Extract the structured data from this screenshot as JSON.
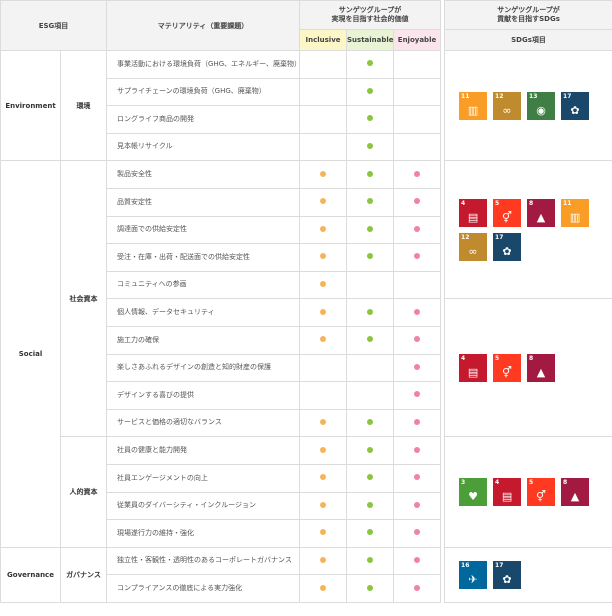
{
  "header": {
    "esg": "ESG項目",
    "materiality": "マテリアリティ（重要課題）",
    "value_title_1": "サンゲツグループが",
    "value_title_2": "実現を目指す社会的価値",
    "sdgs_title_1": "サンゲツグループが",
    "sdgs_title_2": "貢献を目指すSDGs",
    "inclusive": "Inclusive",
    "sustainable": "Sustainable",
    "enjoyable": "Enjoyable",
    "sdgs_item": "SDGs項目"
  },
  "categories": {
    "environment": "Environment",
    "environment_sub": "環境",
    "social": "Social",
    "social_sub1": "社会資本",
    "social_sub2": "人的資本",
    "governance": "Governance",
    "governance_sub": "ガバナンス"
  },
  "rows": [
    {
      "label": "事業活動における環境負荷（GHG、エネルギー、廃棄物）",
      "inclusive": false,
      "sustainable": true,
      "enjoyable": false
    },
    {
      "label": "サプライチェーンの環境負荷（GHG、廃棄物）",
      "inclusive": false,
      "sustainable": true,
      "enjoyable": false
    },
    {
      "label": "ロングライフ商品の開発",
      "inclusive": false,
      "sustainable": true,
      "enjoyable": false
    },
    {
      "label": "見本帳リサイクル",
      "inclusive": false,
      "sustainable": true,
      "enjoyable": false
    },
    {
      "label": "製品安全性",
      "inclusive": true,
      "sustainable": true,
      "enjoyable": true
    },
    {
      "label": "品質安定性",
      "inclusive": true,
      "sustainable": true,
      "enjoyable": true
    },
    {
      "label": "調達面での供給安定性",
      "inclusive": true,
      "sustainable": true,
      "enjoyable": true
    },
    {
      "label": "受注・在庫・出荷・配送面での供給安定性",
      "inclusive": true,
      "sustainable": true,
      "enjoyable": true
    },
    {
      "label": "コミュニティへの参画",
      "inclusive": true,
      "sustainable": false,
      "enjoyable": false
    },
    {
      "label": "個人情報、データセキュリティ",
      "inclusive": true,
      "sustainable": true,
      "enjoyable": true
    },
    {
      "label": "施工力の確保",
      "inclusive": true,
      "sustainable": true,
      "enjoyable": true
    },
    {
      "label": "楽しさあふれるデザインの創造と知的財産の保護",
      "inclusive": false,
      "sustainable": false,
      "enjoyable": true
    },
    {
      "label": "デザインする喜びの提供",
      "inclusive": false,
      "sustainable": false,
      "enjoyable": true
    },
    {
      "label": "サービスと価格の適切なバランス",
      "inclusive": true,
      "sustainable": true,
      "enjoyable": true
    },
    {
      "label": "社員の健康と能力開発",
      "inclusive": true,
      "sustainable": true,
      "enjoyable": true
    },
    {
      "label": "社員エンゲージメントの向上",
      "inclusive": true,
      "sustainable": true,
      "enjoyable": true
    },
    {
      "label": "従業員のダイバーシティ・インクルージョン",
      "inclusive": true,
      "sustainable": true,
      "enjoyable": true
    },
    {
      "label": "現場遂行力の維持・強化",
      "inclusive": true,
      "sustainable": true,
      "enjoyable": true
    },
    {
      "label": "独立性・客観性・透明性のあるコーポレートガバナンス",
      "inclusive": true,
      "sustainable": true,
      "enjoyable": true
    },
    {
      "label": "コンプライアンスの徹底による実力強化",
      "inclusive": true,
      "sustainable": true,
      "enjoyable": true
    }
  ],
  "dot_colors": {
    "inclusive": "#f4b55a",
    "sustainable": "#8cc63f",
    "enjoyable": "#ee82a8"
  },
  "sdg_groups": [
    {
      "icons": [
        {
          "num": "11",
          "color": "#f99d26",
          "icon": "city-icon"
        },
        {
          "num": "12",
          "color": "#bf8b2e",
          "icon": "infinity-icon"
        },
        {
          "num": "13",
          "color": "#3f7e44",
          "icon": "eye-globe-icon"
        },
        {
          "num": "17",
          "color": "#19486a",
          "icon": "flower-icon"
        }
      ]
    },
    {
      "icons": [
        {
          "num": "4",
          "color": "#c5192d",
          "icon": "book-icon"
        },
        {
          "num": "5",
          "color": "#ff3a21",
          "icon": "gender-icon"
        },
        {
          "num": "8",
          "color": "#a21942",
          "icon": "growth-chart-icon"
        },
        {
          "num": "11",
          "color": "#f99d26",
          "icon": "city-icon"
        },
        {
          "num": "12",
          "color": "#bf8b2e",
          "icon": "infinity-icon"
        },
        {
          "num": "17",
          "color": "#19486a",
          "icon": "flower-icon"
        }
      ]
    },
    {
      "icons": [
        {
          "num": "4",
          "color": "#c5192d",
          "icon": "book-icon"
        },
        {
          "num": "5",
          "color": "#ff3a21",
          "icon": "gender-icon"
        },
        {
          "num": "8",
          "color": "#a21942",
          "icon": "growth-chart-icon"
        }
      ]
    },
    {
      "icons": [
        {
          "num": "3",
          "color": "#4c9f38",
          "icon": "heartbeat-icon"
        },
        {
          "num": "4",
          "color": "#c5192d",
          "icon": "book-icon"
        },
        {
          "num": "5",
          "color": "#ff3a21",
          "icon": "gender-icon"
        },
        {
          "num": "8",
          "color": "#a21942",
          "icon": "growth-chart-icon"
        }
      ]
    },
    {
      "icons": [
        {
          "num": "16",
          "color": "#00689d",
          "icon": "dove-icon"
        },
        {
          "num": "17",
          "color": "#19486a",
          "icon": "flower-icon"
        }
      ]
    }
  ]
}
